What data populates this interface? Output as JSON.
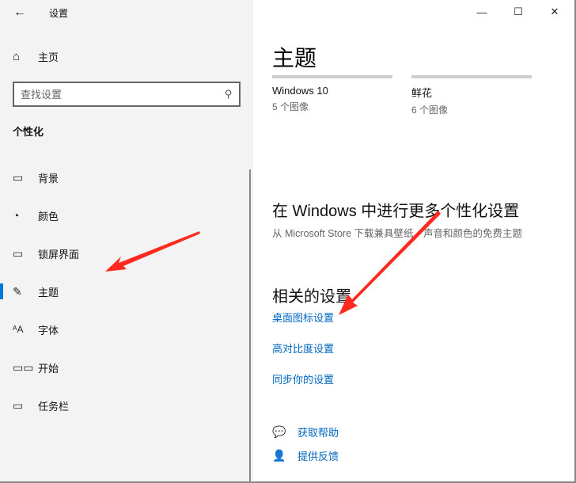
{
  "window": {
    "title": "设置",
    "back_icon": "arrow-left-icon",
    "minimize": "—",
    "maximize": "☐",
    "close": "✕"
  },
  "sidebar": {
    "home": "主页",
    "search_placeholder": "查找设置",
    "section": "个性化",
    "items": [
      {
        "label": "背景",
        "icon": "picture-icon"
      },
      {
        "label": "颜色",
        "icon": "palette-icon"
      },
      {
        "label": "锁屏界面",
        "icon": "lock-screen-icon"
      },
      {
        "label": "主题",
        "icon": "theme-icon",
        "active": true
      },
      {
        "label": "字体",
        "icon": "font-icon"
      },
      {
        "label": "开始",
        "icon": "start-icon"
      },
      {
        "label": "任务栏",
        "icon": "taskbar-icon"
      }
    ]
  },
  "main": {
    "title": "主题",
    "themes": [
      {
        "name": "Windows 10",
        "count": "5 个图像"
      },
      {
        "name": "鲜花",
        "count": "6 个图像"
      }
    ],
    "more_heading": "在 Windows 中进行更多个性化设置",
    "more_sub": "从 Microsoft Store 下载兼具壁纸、声音和颜色的免费主题",
    "related_heading": "相关的设置",
    "related_links": [
      "桌面图标设置",
      "高对比度设置",
      "同步你的设置"
    ],
    "help": "获取帮助",
    "feedback": "提供反馈"
  },
  "colors": {
    "accent": "#0078d7",
    "link": "#0067c0",
    "annotation": "#ff2a1f"
  }
}
